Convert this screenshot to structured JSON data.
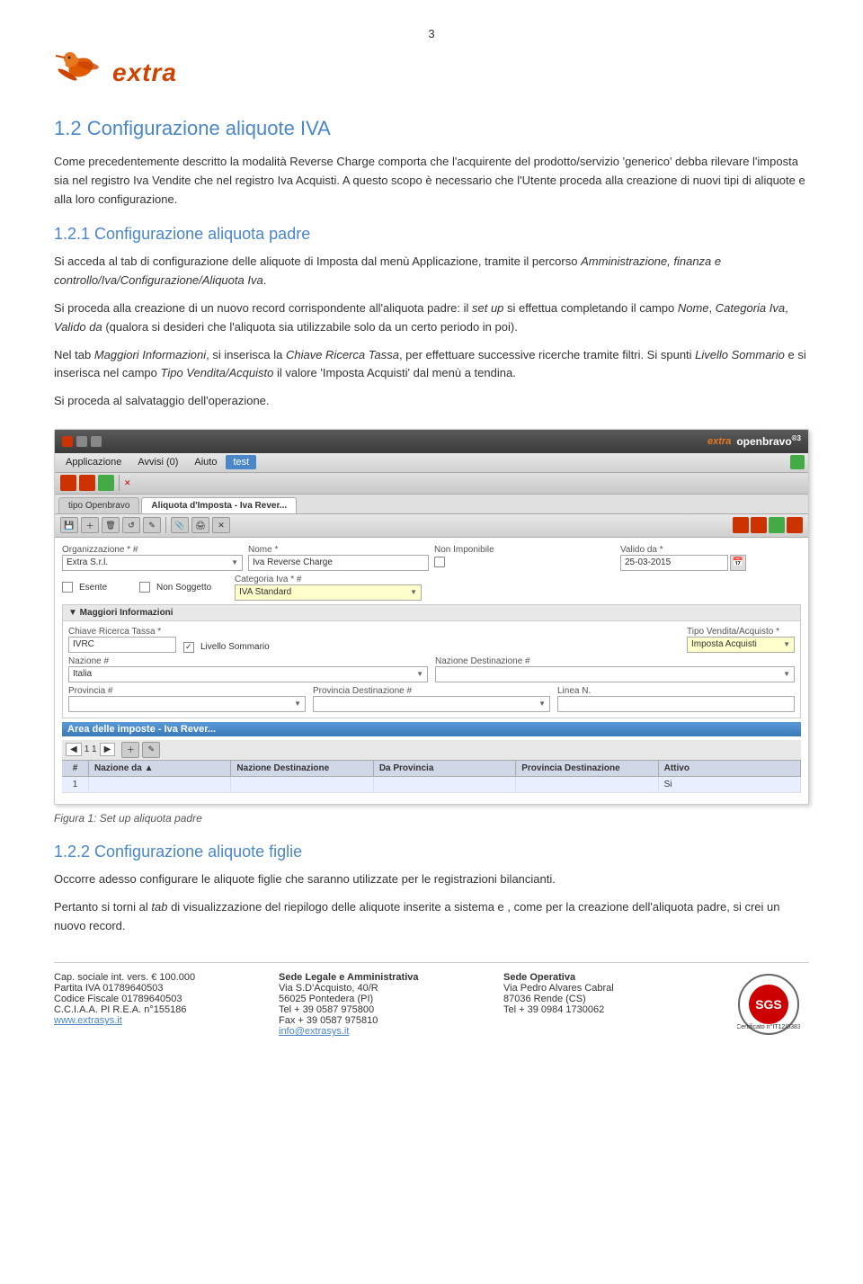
{
  "page": {
    "number": "3",
    "title": "Configurazione aliquote IVA"
  },
  "logo": {
    "alt": "Extra logo",
    "text": "extra"
  },
  "section1": {
    "heading": "1.2  Configurazione aliquote IVA",
    "intro": "Come precedentemente descritto la modalità Reverse Charge comporta che l'acquirente del prodotto/servizio 'generico' debba rilevare l'imposta sia nel registro Iva Vendite che nel registro Iva Acquisti. A questo scopo è necessario che l'Utente proceda alla creazione di nuovi tipi di aliquote e alla loro configurazione."
  },
  "section1_1": {
    "heading": "1.2.1  Configurazione aliquota padre",
    "p1": "Si acceda al tab di configurazione delle aliquote di Imposta dal menù Applicazione, tramite il percorso Amministrazione, finanza e controllo/Iva/Configurazione/Aliquota Iva.",
    "p2": "Si proceda alla creazione di un nuovo record corrispondente all'aliquota padre: il set up si effettua completando il campo Nome, Categoria Iva, Valido da (qualora si desideri che l'aliquota sia utilizzabile solo da un certo periodo in poi).",
    "p3": "Nel tab Maggiori Informazioni, si inserisca la Chiave Ricerca Tassa, per effettuare successive ricerche tramite filtri. Si spunti Livello Sommario e si inserisca nel campo Tipo Vendita/Acquisto il valore 'Imposta Acquisti' dal menù a tendina.",
    "p4": "Si proceda al salvataggio dell'operazione."
  },
  "screenshot": {
    "app_title": "Openbravo",
    "branding": "openbravo³",
    "extra_logo": "extra",
    "menu_items": [
      "Applicazione",
      "Avvisi (0)",
      "Aiuto",
      "test"
    ],
    "tabs": [
      "tipo Openbravo",
      "Aliquota d'Imposta - Iva Rever..."
    ],
    "form": {
      "org_label": "Organizzazione * #",
      "org_value": "Extra S.r.l.",
      "nome_label": "Nome *",
      "nome_value": "Iva Reverse Charge",
      "non_imponibile_label": "Non Imponibile",
      "valido_da_label": "Valido da *",
      "valido_da_value": "25-03-2015",
      "esente_label": "Esente",
      "non_soggetto_label": "Non Soggetto",
      "categoria_iva_label": "Categoria Iva * #",
      "categoria_iva_value": "IVA Standard",
      "maggiori_info_label": "Maggiori Informazioni",
      "chiave_label": "Chiave Ricerca Tassa *",
      "chiave_value": "IVRC",
      "livello_sommario": "Livello Sommario",
      "tipo_vendita_label": "Tipo Vendita/Acquisto *",
      "tipo_vendita_value": "Imposta Acquisti",
      "nazione_label": "Nazione #",
      "nazione_value": "Italia",
      "nazione_dest_label": "Nazione Destinazione #",
      "provincia_label": "Provincia #",
      "provincia_dest_label": "Provincia Destinazione #",
      "linea_label": "Linea N."
    },
    "area_section": "Area delle imposte - Iva Rever...",
    "grid_headers": [
      "Nazione da ▲",
      "Nazione Destinazione",
      "Da Provincia",
      "Provincia Destinazione",
      "Attivo"
    ],
    "grid_row": [
      "",
      "",
      "",
      "",
      "Si"
    ],
    "pagination": "1   1"
  },
  "figure_caption": "Figura 1: Set up aliquota padre",
  "section1_2": {
    "heading": "1.2.2  Configurazione aliquote figlie",
    "p1": "Occorre adesso configurare le aliquote figlie che saranno utilizzate per le registrazioni bilancianti.",
    "p2": "Pertanto si torni al tab di visualizzazione del riepilogo delle aliquote inserite a sistema e , come per la creazione dell'aliquota padre, si crei un nuovo record."
  },
  "footer": {
    "col1": {
      "line1": "Cap. sociale int. vers. € 100.000",
      "line2": "Partita IVA 01789640503",
      "line3": "Codice Fiscale 01789640503",
      "line4": "C.C.I.A.A. PI R.E.A. n°155186",
      "link": "www.extrasys.it"
    },
    "col2": {
      "title": "Sede Legale e Amministrativa",
      "line1": "Via S.D'Acquisto, 40/R",
      "line2": "56025 Pontedera (PI)",
      "line3": "Tel + 39 0587 975800",
      "line4": "Fax + 39 0587 975810",
      "link": "info@extrasys.it"
    },
    "col3": {
      "title": "Sede Operativa",
      "line1": "Via Pedro Alvares Cabral",
      "line2": "87036 Rende (CS)",
      "line3": "Tel + 39 0984 1730062"
    },
    "col4": {
      "cert_text": "Certificato n°IT12/0383",
      "sgs_text": "SGS"
    }
  }
}
